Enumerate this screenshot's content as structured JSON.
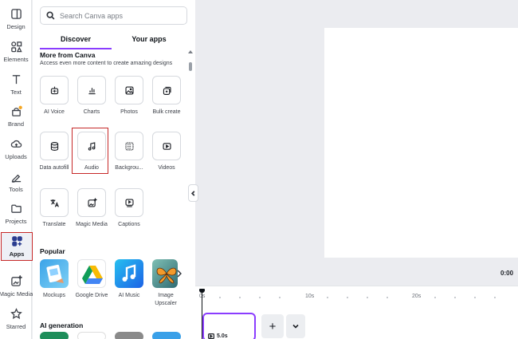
{
  "rail": {
    "items": [
      {
        "label": "Design",
        "icon": "design-icon"
      },
      {
        "label": "Elements",
        "icon": "elements-icon"
      },
      {
        "label": "Text",
        "icon": "text-icon"
      },
      {
        "label": "Brand",
        "icon": "brand-icon"
      },
      {
        "label": "Uploads",
        "icon": "uploads-icon"
      },
      {
        "label": "Tools",
        "icon": "tools-icon"
      },
      {
        "label": "Projects",
        "icon": "projects-icon"
      },
      {
        "label": "Apps",
        "icon": "apps-icon"
      },
      {
        "label": "Magic Media",
        "icon": "magic-media-icon"
      },
      {
        "label": "Starred",
        "icon": "star-icon"
      }
    ]
  },
  "panel": {
    "search_placeholder": "Search Canva apps",
    "tabs": {
      "discover": "Discover",
      "your_apps": "Your apps"
    },
    "more_from_canva": {
      "title": "More from Canva",
      "subtitle": "Access even more content to create amazing designs",
      "apps": [
        {
          "label": "AI Voice",
          "icon": "ai-voice-icon"
        },
        {
          "label": "Charts",
          "icon": "charts-icon"
        },
        {
          "label": "Photos",
          "icon": "photos-icon"
        },
        {
          "label": "Bulk create",
          "icon": "bulk-create-icon"
        },
        {
          "label": "Data autofill",
          "icon": "data-autofill-icon"
        },
        {
          "label": "Audio",
          "icon": "audio-icon"
        },
        {
          "label": "Backgrou...",
          "icon": "backgrounds-icon"
        },
        {
          "label": "Videos",
          "icon": "videos-icon"
        },
        {
          "label": "Translate",
          "icon": "translate-icon"
        },
        {
          "label": "Magic Media",
          "icon": "magic-media-icon"
        },
        {
          "label": "Captions",
          "icon": "captions-icon"
        }
      ]
    },
    "popular": {
      "title": "Popular",
      "apps": [
        {
          "label": "Mockups"
        },
        {
          "label": "Google Drive"
        },
        {
          "label": "AI Music"
        },
        {
          "label": "Image Upscaler"
        }
      ]
    },
    "ai_generation": {
      "title": "AI generation"
    }
  },
  "canvas": {
    "time_readout": "0:00"
  },
  "timeline": {
    "ticks": [
      "0s",
      "10s",
      "20s"
    ],
    "clip_duration": "5.0s",
    "add_label": "+"
  },
  "colors": {
    "accent": "#8b3dff",
    "highlight": "#c62828"
  }
}
